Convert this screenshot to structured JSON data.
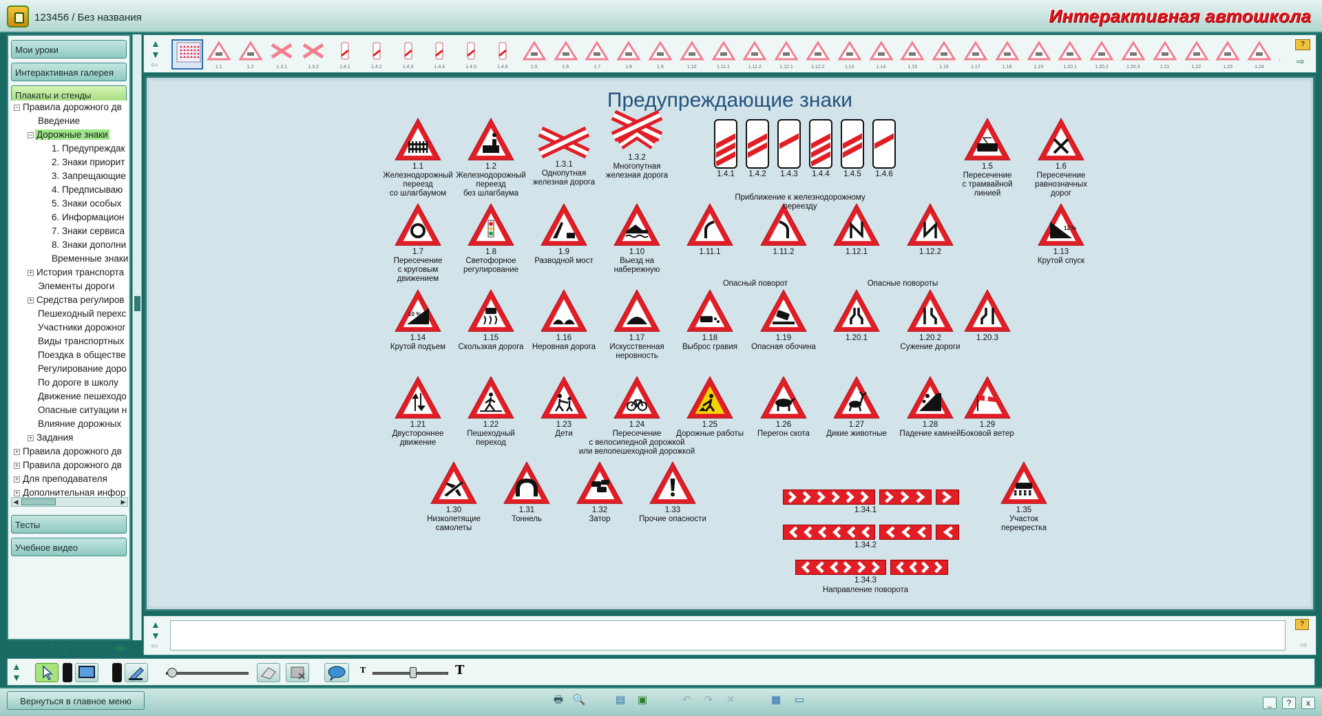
{
  "window": {
    "title": "123456 / Без названия",
    "brand": "Интерактивная автошкола"
  },
  "sidebar": {
    "top_buttons": [
      "Мои уроки",
      "Интерактивная галерея",
      "Плакаты и стенды"
    ],
    "bottom_buttons": [
      "Тесты",
      "Учебное видео"
    ],
    "tree": [
      {
        "label": "Правила дорожного дв",
        "level": 0,
        "toggle": "−"
      },
      {
        "label": "Введение",
        "level": 1,
        "toggle": ""
      },
      {
        "label": "Дорожные знаки",
        "level": 1,
        "toggle": "−",
        "selected": true
      },
      {
        "label": "1. Предупреждак",
        "level": 2,
        "toggle": ""
      },
      {
        "label": "2. Знаки приорит",
        "level": 2,
        "toggle": ""
      },
      {
        "label": "3. Запрещающие",
        "level": 2,
        "toggle": ""
      },
      {
        "label": "4. Предписываю",
        "level": 2,
        "toggle": ""
      },
      {
        "label": "5. Знаки особых",
        "level": 2,
        "toggle": ""
      },
      {
        "label": "6. Информацион",
        "level": 2,
        "toggle": ""
      },
      {
        "label": "7. Знаки сервиса",
        "level": 2,
        "toggle": ""
      },
      {
        "label": "8. Знаки дополни",
        "level": 2,
        "toggle": ""
      },
      {
        "label": "Временные знаки",
        "level": 2,
        "toggle": ""
      },
      {
        "label": "История транспорта",
        "level": 1,
        "toggle": "+"
      },
      {
        "label": "Элементы дороги",
        "level": 1,
        "toggle": ""
      },
      {
        "label": "Средства регулиров",
        "level": 1,
        "toggle": "+"
      },
      {
        "label": "Пешеходный перехс",
        "level": 1,
        "toggle": ""
      },
      {
        "label": "Участники дорожног",
        "level": 1,
        "toggle": ""
      },
      {
        "label": "Виды транспортных",
        "level": 1,
        "toggle": ""
      },
      {
        "label": "Поездка в обществе",
        "level": 1,
        "toggle": ""
      },
      {
        "label": "Регулирование доро",
        "level": 1,
        "toggle": ""
      },
      {
        "label": "По дороге в школу",
        "level": 1,
        "toggle": ""
      },
      {
        "label": "Движение пешеходо",
        "level": 1,
        "toggle": ""
      },
      {
        "label": "Опасные ситуации н",
        "level": 1,
        "toggle": ""
      },
      {
        "label": "Влияние дорожных",
        "level": 1,
        "toggle": ""
      },
      {
        "label": "Задания",
        "level": 1,
        "toggle": "+"
      },
      {
        "label": "Правила дорожного дв",
        "level": 0,
        "toggle": "+"
      },
      {
        "label": "Правила дорожного дв",
        "level": 0,
        "toggle": "+"
      },
      {
        "label": "Для преподавателя",
        "level": 0,
        "toggle": "+"
      },
      {
        "label": "Дополнительная инфор",
        "level": 0,
        "toggle": "+"
      }
    ]
  },
  "strip": {
    "labels": [
      "",
      "1.1",
      "1.2",
      "1.3.1",
      "1.3.2",
      "1.4.1",
      "1.4.2",
      "1.4.3",
      "1.4.4",
      "1.4.5",
      "1.4.6",
      "1.5",
      "1.6",
      "1.7",
      "1.8",
      "1.9",
      "1.10",
      "1.11.1",
      "1.11.2",
      "1.12.1",
      "1.12.2",
      "1.13",
      "1.14",
      "1.15",
      "1.16",
      "1.17",
      "1.18",
      "1.19",
      "1.20.1",
      "1.20.2",
      "1.20.3",
      "1.21",
      "1.22",
      "1.23",
      "1.24",
      "1.25"
    ]
  },
  "poster": {
    "title": "Предупреждающие знаки",
    "signs": [
      {
        "code": "1.1",
        "desc": "Железнодорожный\nпереезд\nсо шлагбаумом",
        "shape": "tri",
        "glyph": "fence"
      },
      {
        "code": "1.2",
        "desc": "Железнодорожный\nпереезд\nбез шлагбаума",
        "shape": "tri",
        "glyph": "train"
      },
      {
        "code": "1.3.1",
        "desc": "Однопутная\nжелезная дорога",
        "shape": "cross1",
        "glyph": ""
      },
      {
        "code": "1.3.2",
        "desc": "Многопутная\nжелезная дорога",
        "shape": "cross2",
        "glyph": ""
      },
      {
        "code": "1.4.1",
        "desc": "",
        "shape": "bar",
        "stripes": 3
      },
      {
        "code": "1.4.2",
        "desc": "",
        "shape": "bar",
        "stripes": 2
      },
      {
        "code": "1.4.3",
        "desc": "",
        "shape": "bar",
        "stripes": 1
      },
      {
        "code": "1.4.4",
        "desc": "",
        "shape": "bar",
        "stripes": 3
      },
      {
        "code": "1.4.5",
        "desc": "",
        "shape": "bar",
        "stripes": 2
      },
      {
        "code": "1.4.6",
        "desc": "",
        "shape": "bar",
        "stripes": 1
      },
      {
        "code": "1.5",
        "desc": "Пересечение\nс трамвайной\nлинией",
        "shape": "tri",
        "glyph": "tram"
      },
      {
        "code": "1.6",
        "desc": "Пересечение\nравнозначных\nдорог",
        "shape": "tri",
        "glyph": "x"
      },
      {
        "code": "1.7",
        "desc": "Пересечение\nс круговым\nдвижением",
        "shape": "tri",
        "glyph": "circle"
      },
      {
        "code": "1.8",
        "desc": "Светофорное\nрегулирование",
        "shape": "tri",
        "glyph": "light"
      },
      {
        "code": "1.9",
        "desc": "Разводной мост",
        "shape": "tri",
        "glyph": "bridge"
      },
      {
        "code": "1.10",
        "desc": "Выезд на\nнабережную",
        "shape": "tri",
        "glyph": "quay"
      },
      {
        "code": "1.11.1",
        "desc": "",
        "shape": "tri",
        "glyph": "curveR"
      },
      {
        "code": "1.11.2",
        "desc": "",
        "shape": "tri",
        "glyph": "curveL"
      },
      {
        "code": "1.12.1",
        "desc": "",
        "shape": "tri",
        "glyph": "zig1"
      },
      {
        "code": "1.12.2",
        "desc": "",
        "shape": "tri",
        "glyph": "zig2"
      },
      {
        "code": "1.13",
        "desc": "Крутой спуск",
        "shape": "tri",
        "glyph": "down",
        "text": "12 %"
      },
      {
        "code": "1.14",
        "desc": "Крутой подъем",
        "shape": "tri",
        "glyph": "up",
        "text": "10 %"
      },
      {
        "code": "1.15",
        "desc": "Скользкая дорога",
        "shape": "tri",
        "glyph": "slip"
      },
      {
        "code": "1.16",
        "desc": "Неровная дорога",
        "shape": "tri",
        "glyph": "bumps"
      },
      {
        "code": "1.17",
        "desc": "Искусственная\nнеровность",
        "shape": "tri",
        "glyph": "hump"
      },
      {
        "code": "1.18",
        "desc": "Выброс гравия",
        "shape": "tri",
        "glyph": "gravel"
      },
      {
        "code": "1.19",
        "desc": "Опасная обочина",
        "shape": "tri",
        "glyph": "shoulder"
      },
      {
        "code": "1.20.1",
        "desc": "",
        "shape": "tri",
        "glyph": "narrowBoth"
      },
      {
        "code": "1.20.2",
        "desc": "Сужение дороги",
        "shape": "tri",
        "glyph": "narrowR"
      },
      {
        "code": "1.20.3",
        "desc": "",
        "shape": "tri",
        "glyph": "narrowL"
      },
      {
        "code": "1.21",
        "desc": "Двустороннее\nдвижение",
        "shape": "tri",
        "glyph": "twoway"
      },
      {
        "code": "1.22",
        "desc": "Пешеходный\nпереход",
        "shape": "tri",
        "glyph": "ped"
      },
      {
        "code": "1.23",
        "desc": "Дети",
        "shape": "tri",
        "glyph": "kids"
      },
      {
        "code": "1.24",
        "desc": "Пересечение\nс велосипедной дорожкой\nили велопешеходной дорожкой",
        "shape": "tri",
        "glyph": "bike"
      },
      {
        "code": "1.25",
        "desc": "Дорожные работы",
        "shape": "triY",
        "glyph": "work"
      },
      {
        "code": "1.26",
        "desc": "Перегон скота",
        "shape": "tri",
        "glyph": "cow"
      },
      {
        "code": "1.27",
        "desc": "Дикие животные",
        "shape": "tri",
        "glyph": "deer"
      },
      {
        "code": "1.28",
        "desc": "Падение камней",
        "shape": "tri",
        "glyph": "rocks"
      },
      {
        "code": "1.29",
        "desc": "Боковой ветер",
        "shape": "tri",
        "glyph": "wind"
      },
      {
        "code": "1.30",
        "desc": "Низколетящие\nсамолеты",
        "shape": "tri",
        "glyph": "plane"
      },
      {
        "code": "1.31",
        "desc": "Тоннель",
        "shape": "tri",
        "glyph": "tunnel"
      },
      {
        "code": "1.32",
        "desc": "Затор",
        "shape": "tri",
        "glyph": "jam"
      },
      {
        "code": "1.33",
        "desc": "Прочие опасности",
        "shape": "tri",
        "glyph": "excl"
      },
      {
        "code": "1.35",
        "desc": "Участок перекрестка",
        "shape": "tri",
        "glyph": "grid"
      }
    ],
    "group_labels": {
      "railway_approach": "Приближение к железнодорожному переезду",
      "dangerous_turn": "Опасный поворот",
      "dangerous_turns": "Опасные повороты",
      "turn_direction": "Направление поворота"
    },
    "chevrons": [
      {
        "code": "1.34.1",
        "dir": "right"
      },
      {
        "code": "1.34.2",
        "dir": "left"
      },
      {
        "code": "1.34.3",
        "dir": "both"
      }
    ]
  },
  "toolbar": {},
  "footer": {
    "back_button": "Вернуться в главное меню",
    "help": "?",
    "close": "x",
    "minimize": "_"
  },
  "colors": {
    "sign_red": "#e11e26",
    "accent": "#2f7a74",
    "brand_red": "#e5141c"
  }
}
